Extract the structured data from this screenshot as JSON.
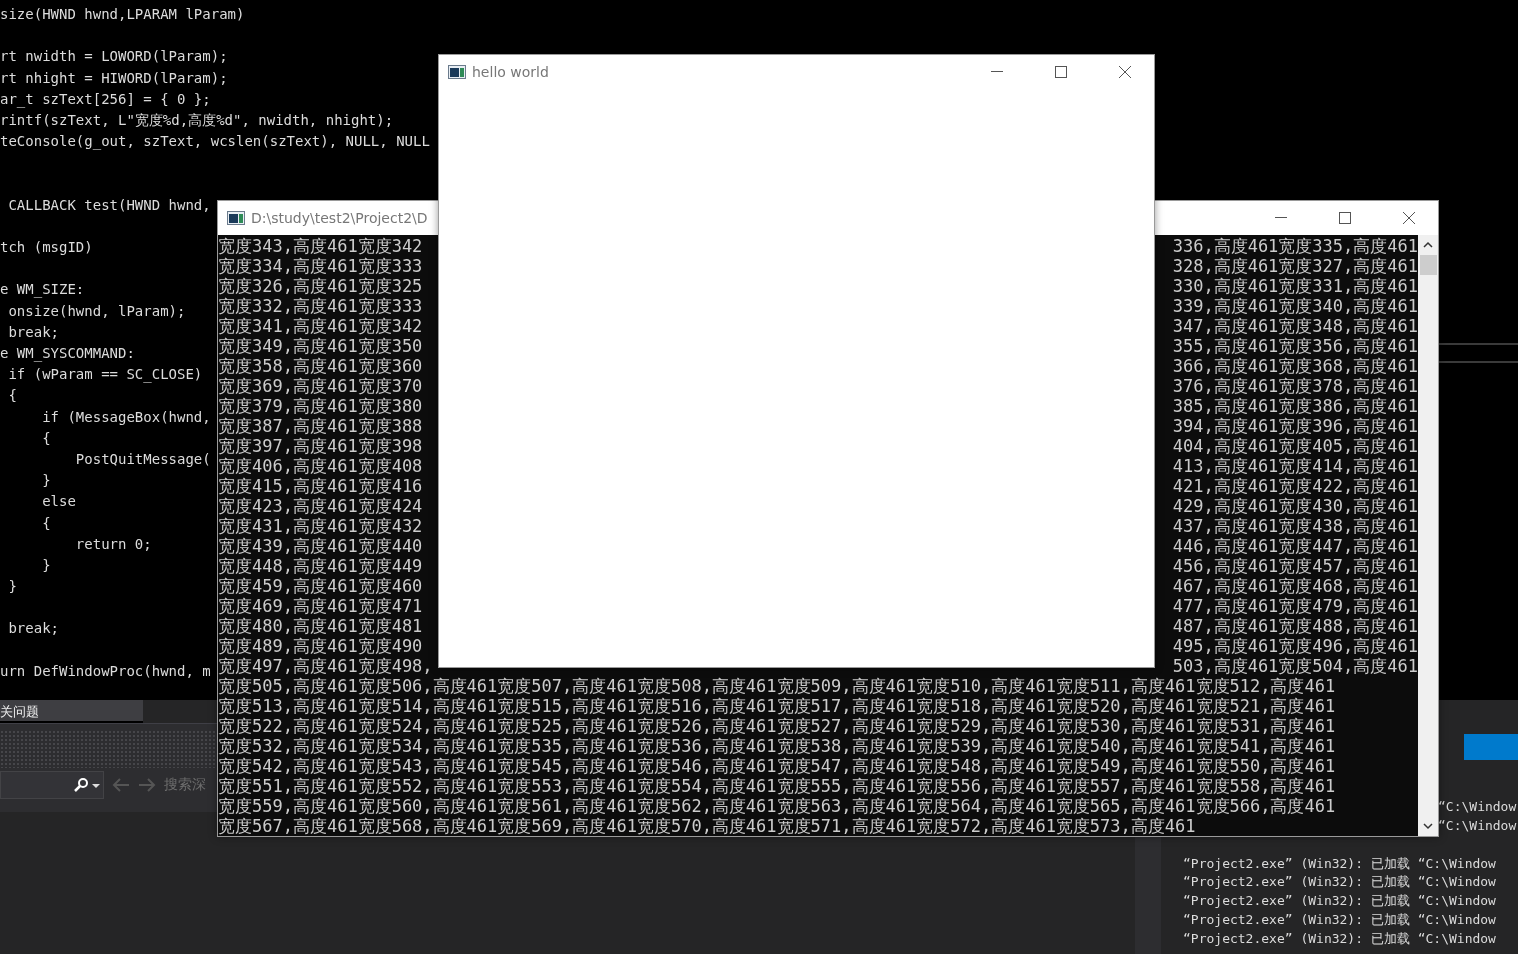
{
  "editor": {
    "lines": [
      {
        "kind": "code",
        "text": "size(HWND hwnd,LPARAM lParam)"
      },
      {
        "kind": "blank"
      },
      {
        "kind": "code",
        "text": "rt nwidth = LOWORD(lParam);"
      },
      {
        "kind": "code",
        "text": "rt nhight = HIWORD(lParam);"
      },
      {
        "kind": "code",
        "text": "ar_t szText[256] = { 0 };"
      },
      {
        "kind": "code",
        "text": "rintf(szText, L\"宽度%d,高度%d\", nwidth, nhight);"
      },
      {
        "kind": "code",
        "text": "teConsole(g_out, szText, wcslen(szText), NULL, NULL"
      },
      {
        "kind": "blank"
      },
      {
        "kind": "blank"
      },
      {
        "kind": "code",
        "text": " CALLBACK test(HWND hwnd,"
      },
      {
        "kind": "blank"
      },
      {
        "kind": "code",
        "text": "tch (msgID)"
      },
      {
        "kind": "blank"
      },
      {
        "kind": "code",
        "text": "e WM_SIZE:"
      },
      {
        "kind": "code",
        "text": " onsize(hwnd, lParam);"
      },
      {
        "kind": "code",
        "text": " break;"
      },
      {
        "kind": "code",
        "text": "e WM_SYSCOMMAND:"
      },
      {
        "kind": "code",
        "text": " if (wParam == SC_CLOSE)"
      },
      {
        "kind": "code",
        "text": " {"
      },
      {
        "kind": "code",
        "text": "     if (MessageBox(hwnd,"
      },
      {
        "kind": "code",
        "text": "     {"
      },
      {
        "kind": "code",
        "text": "         PostQuitMessage("
      },
      {
        "kind": "code",
        "text": "     }"
      },
      {
        "kind": "code",
        "text": "     else"
      },
      {
        "kind": "code",
        "text": "     {"
      },
      {
        "kind": "code",
        "text": "         return 0;"
      },
      {
        "kind": "code",
        "text": "     }"
      },
      {
        "kind": "code",
        "text": " }"
      },
      {
        "kind": "blank"
      },
      {
        "kind": "code",
        "text": " break;"
      },
      {
        "kind": "blank"
      },
      {
        "kind": "code",
        "text": "urn DefWindowProc(hwnd, m"
      }
    ]
  },
  "bottom_panel": {
    "tab": "关问题",
    "search_hint": "搜索深"
  },
  "output": {
    "lines": [
      "“C:\\Window",
      "“C:\\Window",
      "“Project2.exe” (Win32): 已加载 “C:\\Window",
      "“Project2.exe” (Win32): 已加载 “C:\\Window",
      "“Project2.exe” (Win32): 已加载 “C:\\Window",
      "“Project2.exe” (Win32): 已加载 “C:\\Window",
      "“Project2.exe” (Win32): 已加载 “C:\\Window"
    ]
  },
  "console_window": {
    "title": "D:\\study\\test2\\Project2\\D",
    "split_rows": [
      {
        "left": "宽度343,高度461宽度342",
        "right": "336,高度461宽度335,高度461"
      },
      {
        "left": "宽度334,高度461宽度333",
        "right": "328,高度461宽度327,高度461"
      },
      {
        "left": "宽度326,高度461宽度325",
        "right": "330,高度461宽度331,高度461"
      },
      {
        "left": "宽度332,高度461宽度333",
        "right": "339,高度461宽度340,高度461"
      },
      {
        "left": "宽度341,高度461宽度342",
        "right": "347,高度461宽度348,高度461"
      },
      {
        "left": "宽度349,高度461宽度350",
        "right": "355,高度461宽度356,高度461"
      },
      {
        "left": "宽度358,高度461宽度360",
        "right": "366,高度461宽度368,高度461"
      },
      {
        "left": "宽度369,高度461宽度370",
        "right": "376,高度461宽度378,高度461"
      },
      {
        "left": "宽度379,高度461宽度380",
        "right": "385,高度461宽度386,高度461"
      },
      {
        "left": "宽度387,高度461宽度388",
        "right": "394,高度461宽度396,高度461"
      },
      {
        "left": "宽度397,高度461宽度398",
        "right": "404,高度461宽度405,高度461"
      },
      {
        "left": "宽度406,高度461宽度408",
        "right": "413,高度461宽度414,高度461"
      },
      {
        "left": "宽度415,高度461宽度416",
        "right": "421,高度461宽度422,高度461"
      },
      {
        "left": "宽度423,高度461宽度424",
        "right": "429,高度461宽度430,高度461"
      },
      {
        "left": "宽度431,高度461宽度432",
        "right": "437,高度461宽度438,高度461"
      },
      {
        "left": "宽度439,高度461宽度440",
        "right": "446,高度461宽度447,高度461"
      },
      {
        "left": "宽度448,高度461宽度449",
        "right": "456,高度461宽度457,高度461"
      },
      {
        "left": "宽度459,高度461宽度460",
        "right": "467,高度461宽度468,高度461"
      },
      {
        "left": "宽度469,高度461宽度471",
        "right": "477,高度461宽度479,高度461"
      },
      {
        "left": "宽度480,高度461宽度481",
        "right": "487,高度461宽度488,高度461"
      },
      {
        "left": "宽度489,高度461宽度490",
        "right": "495,高度461宽度496,高度461"
      },
      {
        "left": "宽度497,高度461宽度498,",
        "right": "503,高度461宽度504,高度461"
      }
    ],
    "full_rows": [
      "宽度505,高度461宽度506,高度461宽度507,高度461宽度508,高度461宽度509,高度461宽度510,高度461宽度511,高度461宽度512,高度461",
      "宽度513,高度461宽度514,高度461宽度515,高度461宽度516,高度461宽度517,高度461宽度518,高度461宽度520,高度461宽度521,高度461",
      "宽度522,高度461宽度524,高度461宽度525,高度461宽度526,高度461宽度527,高度461宽度529,高度461宽度530,高度461宽度531,高度461",
      "宽度532,高度461宽度534,高度461宽度535,高度461宽度536,高度461宽度538,高度461宽度539,高度461宽度540,高度461宽度541,高度461",
      "宽度542,高度461宽度543,高度461宽度545,高度461宽度546,高度461宽度547,高度461宽度548,高度461宽度549,高度461宽度550,高度461",
      "宽度551,高度461宽度552,高度461宽度553,高度461宽度554,高度461宽度555,高度461宽度556,高度461宽度557,高度461宽度558,高度461",
      "宽度559,高度461宽度560,高度461宽度561,高度461宽度562,高度461宽度563,高度461宽度564,高度461宽度565,高度461宽度566,高度461",
      "宽度567,高度461宽度568,高度461宽度569,高度461宽度570,高度461宽度571,高度461宽度572,高度461宽度573,高度461"
    ]
  },
  "hello_window": {
    "title": "hello world"
  }
}
